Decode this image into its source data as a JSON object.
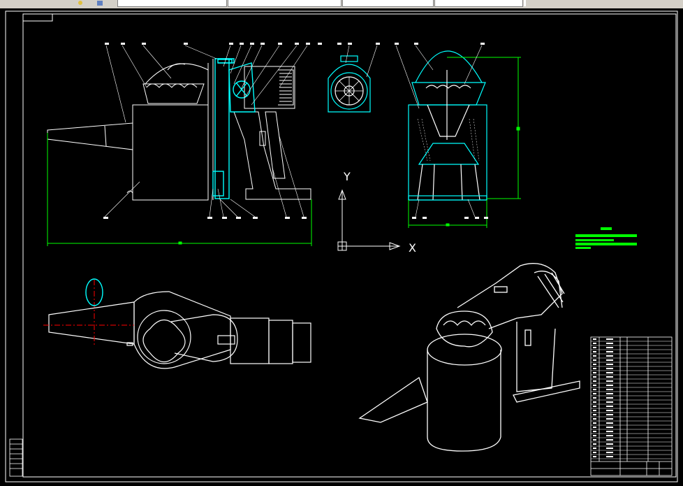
{
  "toolbar": {
    "fields": [
      {
        "name": "layer-dropdown",
        "value": ""
      },
      {
        "name": "color-dropdown",
        "value": ""
      },
      {
        "name": "linetype-dropdown",
        "value": ""
      },
      {
        "name": "lineweight-dropdown",
        "value": ""
      },
      {
        "name": "plotstyle-dropdown",
        "value": ""
      }
    ]
  },
  "drawing": {
    "ucs": {
      "x_label": "X",
      "y_label": "Y"
    },
    "colors": {
      "line": "#ffffff",
      "cyan": "#00ffff",
      "green": "#00ff00",
      "red": "#ff0000",
      "background": "#000000"
    }
  }
}
